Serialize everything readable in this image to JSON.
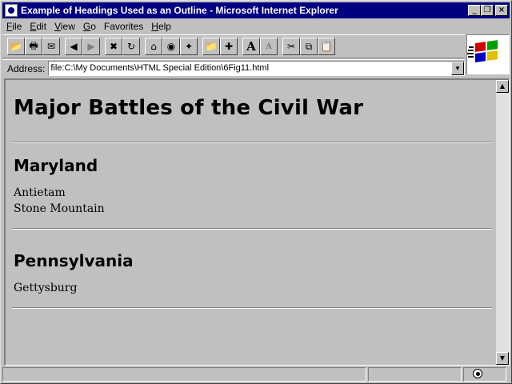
{
  "window": {
    "title": "Example of Headings Used as an Outline - Microsoft Internet Explorer",
    "buttons": {
      "minimize": "_",
      "maximize": "❐",
      "close": "×"
    }
  },
  "menu": [
    {
      "underline": "F",
      "rest": "ile"
    },
    {
      "underline": "E",
      "rest": "dit"
    },
    {
      "underline": "V",
      "rest": "iew"
    },
    {
      "underline": "G",
      "rest": "o"
    },
    {
      "underline": "",
      "rest": "Favorites"
    },
    {
      "underline": "H",
      "rest": "elp"
    }
  ],
  "toolbar": {
    "icons": {
      "open": "📂",
      "print": "🖶",
      "mail": "✉",
      "back": "◀",
      "forward": "▶",
      "stop": "✖",
      "refresh": "↻",
      "home": "⌂",
      "search": "◉",
      "favorites": "✦",
      "open_favorites": "📁",
      "add_favorite": "✚",
      "font_larger": "A",
      "font_smaller": "A",
      "cut": "✂",
      "copy": "⧉",
      "paste": "📋"
    }
  },
  "address": {
    "label": "Address:",
    "value": "file:C:\\My Documents\\HTML Special Edition\\6Fig11.html",
    "dropdown": "▼"
  },
  "page": {
    "h1": "Major Battles of the Civil War",
    "sections": [
      {
        "heading": "Maryland",
        "items": [
          "Antietam",
          "Stone Mountain"
        ]
      },
      {
        "heading": "Pennsylvania",
        "items": [
          "Gettysburg"
        ]
      }
    ]
  },
  "scrollbar": {
    "up": "▲",
    "down": "▼"
  },
  "status": {
    "text": "",
    "zone": ""
  },
  "colors": {
    "titlebar": "#000080",
    "chrome": "#c0c0c0"
  }
}
